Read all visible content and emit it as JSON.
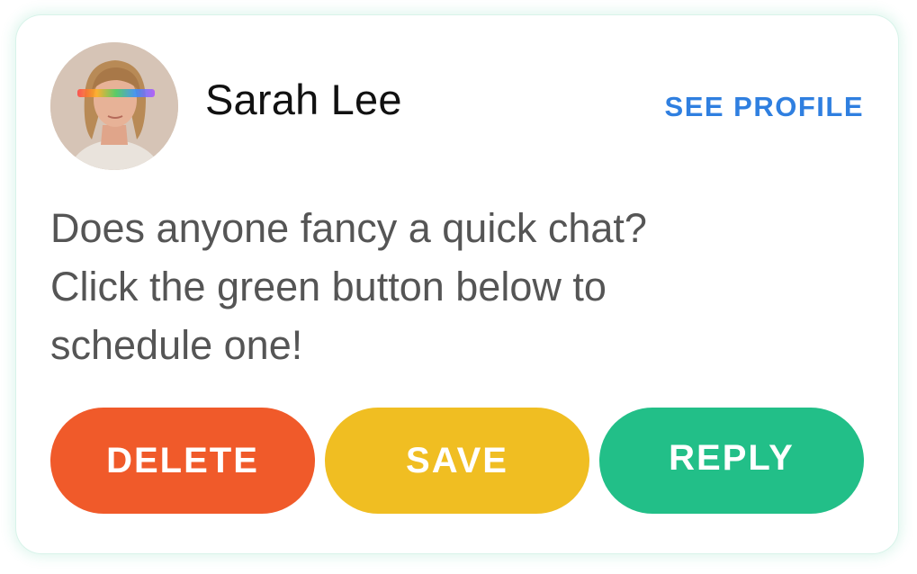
{
  "user": {
    "name": "Sarah Lee",
    "avatar_icon": "profile-photo"
  },
  "header": {
    "see_profile_label": "SEE PROFILE"
  },
  "message": {
    "lines": [
      "Does anyone fancy a quick chat?",
      "Click the green button below to",
      "schedule one!"
    ]
  },
  "actions": {
    "delete_label": "DELETE",
    "save_label": "SAVE",
    "reply_label": "REPLY"
  },
  "colors": {
    "link": "#2f7fe0",
    "delete": "#f05a2a",
    "save": "#f0be22",
    "reply": "#22bf88",
    "message_text": "#555555",
    "name_text": "#111111"
  }
}
